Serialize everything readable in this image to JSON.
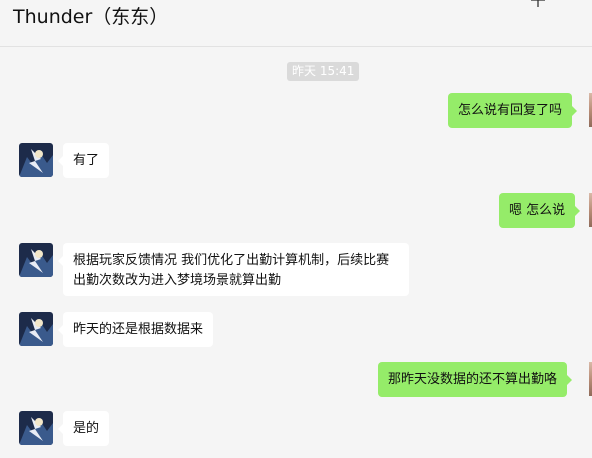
{
  "header": {
    "title": "Thunder（东东）"
  },
  "timestamp": "昨天 15:41",
  "messages": [
    {
      "side": "outgoing",
      "text": "怎么说有回复了吗"
    },
    {
      "side": "incoming",
      "text": "有了"
    },
    {
      "side": "outgoing",
      "text": "嗯 怎么说"
    },
    {
      "side": "incoming",
      "text": "根据玩家反馈情况 我们优化了出勤计算机制，后续比赛出勤次数改为进入梦境场景就算出勤"
    },
    {
      "side": "incoming",
      "text": "昨天的还是根据数据来"
    },
    {
      "side": "outgoing",
      "text": "那昨天没数据的还不算出勤咯"
    },
    {
      "side": "incoming",
      "text": "是的"
    }
  ],
  "colors": {
    "outgoing_bubble": "#95ec69",
    "incoming_bubble": "#ffffff",
    "background": "#f5f5f5"
  }
}
